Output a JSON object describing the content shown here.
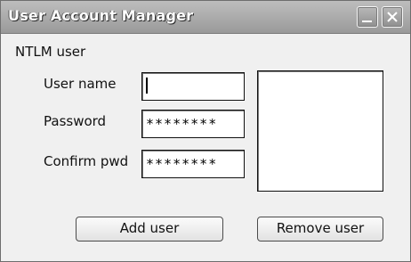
{
  "window": {
    "title": "User Account Manager"
  },
  "titlebar_buttons": {
    "minimize_icon": "minimize-icon",
    "close_icon": "close-icon"
  },
  "form": {
    "group_label": "NTLM user",
    "username_label": "User name",
    "username_value": "",
    "password_label": "Password",
    "password_value": "********",
    "confirm_label": "Confirm pwd",
    "confirm_value": "********"
  },
  "user_list": {
    "items": []
  },
  "buttons": {
    "add_user": "Add user",
    "remove_user": "Remove user"
  },
  "colors": {
    "title_text": "#ffffff",
    "titlebar": "#a8a8a8",
    "window_bg": "#f0f0f0"
  }
}
